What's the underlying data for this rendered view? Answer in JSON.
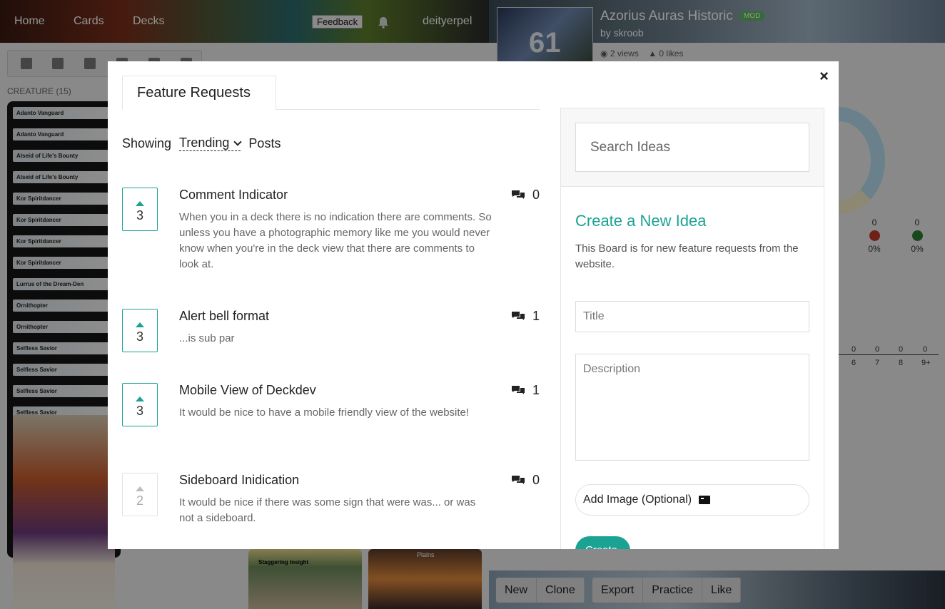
{
  "nav": {
    "home": "Home",
    "cards": "Cards",
    "decks": "Decks",
    "feedback": "Feedback",
    "username": "deityerpel"
  },
  "deck": {
    "count": "61",
    "title": "Azorius Auras Historic",
    "mod_badge": "MOD",
    "author": "by skroob",
    "views": "2 views",
    "likes": "0 likes"
  },
  "left": {
    "section_label": "CREATURE (15)",
    "cards": [
      "Adanto Vanguard",
      "Adanto Vanguard",
      "Alseid of Life's Bounty",
      "Alseid of Life's Bounty",
      "Kor Spiritdancer",
      "Kor Spiritdancer",
      "Kor Spiritdancer",
      "Kor Spiritdancer",
      "Lurrus of the Dream-Den",
      "Ornithopter",
      "Ornithopter",
      "Selfless Savior",
      "Selfless Savior",
      "Selfless Savior",
      "Selfless Savior"
    ]
  },
  "stats": {
    "mana": [
      {
        "count": "0",
        "pct": "0%",
        "color": "#c0392b"
      },
      {
        "count": "0",
        "pct": "0%",
        "color": "#2e7d32"
      }
    ],
    "curve_counts": [
      "0",
      "0",
      "0",
      "0"
    ],
    "curve_labels": [
      "6",
      "7",
      "8",
      "9+"
    ]
  },
  "bottom_cards": {
    "left": "Staggering Insight",
    "right": "Plains"
  },
  "bottom_bar": {
    "new": "New",
    "clone": "Clone",
    "export": "Export",
    "practice": "Practice",
    "like": "Like"
  },
  "modal": {
    "close": "×",
    "tab": "Feature Requests",
    "showing_prefix": "Showing",
    "sort_value": "Trending",
    "showing_suffix": "Posts",
    "posts": [
      {
        "votes": "3",
        "title": "Comment Indicator",
        "desc": "When you in a deck there is no indication there are comments. So unless you have a photographic memory like me you would never know when you're in the deck view that there are comments to look at.",
        "comments": "0"
      },
      {
        "votes": "3",
        "title": "Alert bell format",
        "desc": "...is sub par",
        "comments": "1"
      },
      {
        "votes": "3",
        "title": "Mobile View of Deckdev",
        "desc": "It would be nice to have a mobile friendly view of the website!",
        "comments": "1"
      },
      {
        "votes": "2",
        "title": "Sideboard Inidication",
        "desc": "It would be nice if there was some sign that were was... or was not a sideboard.",
        "comments": "0"
      }
    ],
    "search_placeholder": "Search Ideas",
    "create_title": "Create a New Idea",
    "create_desc": "This Board is for new feature requests from the website.",
    "title_placeholder": "Title",
    "desc_placeholder": "Description",
    "add_image": "Add Image (Optional)",
    "create_button": "Create"
  }
}
